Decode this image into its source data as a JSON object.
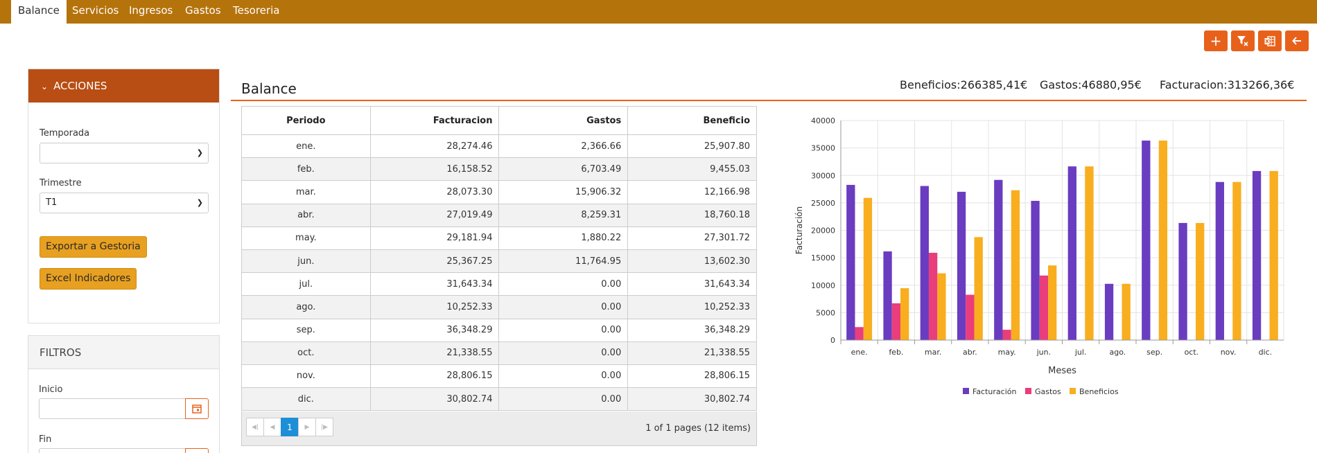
{
  "nav": {
    "tabs": [
      {
        "label": "Balance",
        "active": true
      },
      {
        "label": "Servicios",
        "active": false
      },
      {
        "label": "Ingresos",
        "active": false
      },
      {
        "label": "Gastos",
        "active": false
      },
      {
        "label": "Tesoreria",
        "active": false
      }
    ]
  },
  "toolbar": {
    "icons": [
      "plus-icon",
      "filter-clear-icon",
      "excel-icon",
      "arrow-left-icon"
    ]
  },
  "acciones": {
    "title": "ACCIONES",
    "temporada_label": "Temporada",
    "temporada_value": "",
    "trimestre_label": "Trimestre",
    "trimestre_value": "T1",
    "export_btn": "Exportar a Gestoria",
    "excel_btn": "Excel Indicadores"
  },
  "filtros": {
    "title": "FILTROS",
    "inicio_label": "Inicio",
    "inicio_value": "",
    "fin_label": "Fin",
    "fin_value": ""
  },
  "balance": {
    "title": "Balance",
    "beneficios": "Beneficios:266385,41€",
    "gastos": "Gastos:46880,95€",
    "facturacion": "Facturacion:313266,36€"
  },
  "table": {
    "headers": [
      "Periodo",
      "Facturacion",
      "Gastos",
      "Beneficio"
    ],
    "rows": [
      [
        "ene.",
        "28,274.46",
        "2,366.66",
        "25,907.80"
      ],
      [
        "feb.",
        "16,158.52",
        "6,703.49",
        "9,455.03"
      ],
      [
        "mar.",
        "28,073.30",
        "15,906.32",
        "12,166.98"
      ],
      [
        "abr.",
        "27,019.49",
        "8,259.31",
        "18,760.18"
      ],
      [
        "may.",
        "29,181.94",
        "1,880.22",
        "27,301.72"
      ],
      [
        "jun.",
        "25,367.25",
        "11,764.95",
        "13,602.30"
      ],
      [
        "jul.",
        "31,643.34",
        "0.00",
        "31,643.34"
      ],
      [
        "ago.",
        "10,252.33",
        "0.00",
        "10,252.33"
      ],
      [
        "sep.",
        "36,348.29",
        "0.00",
        "36,348.29"
      ],
      [
        "oct.",
        "21,338.55",
        "0.00",
        "21,338.55"
      ],
      [
        "nov.",
        "28,806.15",
        "0.00",
        "28,806.15"
      ],
      [
        "dic.",
        "30,802.74",
        "0.00",
        "30,802.74"
      ]
    ],
    "pager": {
      "current": "1",
      "info": "1 of 1 pages (12 items)"
    }
  },
  "chart_data": {
    "type": "bar",
    "categories": [
      "ene.",
      "feb.",
      "mar.",
      "abr.",
      "may.",
      "jun.",
      "jul.",
      "ago.",
      "sep.",
      "oct.",
      "nov.",
      "dic."
    ],
    "series": [
      {
        "name": "Facturación",
        "color": "#6a3cc0",
        "values": [
          28274.46,
          16158.52,
          28073.3,
          27019.49,
          29181.94,
          25367.25,
          31643.34,
          10252.33,
          36348.29,
          21338.55,
          28806.15,
          30802.74
        ]
      },
      {
        "name": "Gastos",
        "color": "#ea3d7c",
        "values": [
          2366.66,
          6703.49,
          15906.32,
          8259.31,
          1880.22,
          11764.95,
          0,
          0,
          0,
          0,
          0,
          0
        ]
      },
      {
        "name": "Beneficios",
        "color": "#f8ae1f",
        "values": [
          25907.8,
          9455.03,
          12166.98,
          18760.18,
          27301.72,
          13602.3,
          31643.34,
          10252.33,
          36348.29,
          21338.55,
          28806.15,
          30802.74
        ]
      }
    ],
    "xlabel": "Meses",
    "ylabel": "Facturación",
    "ylim": [
      0,
      40000
    ],
    "yticks": [
      "0",
      "5000",
      "10000",
      "15000",
      "20000",
      "25000",
      "30000",
      "35000",
      "40000"
    ],
    "grid": true,
    "legend": "bottom"
  }
}
